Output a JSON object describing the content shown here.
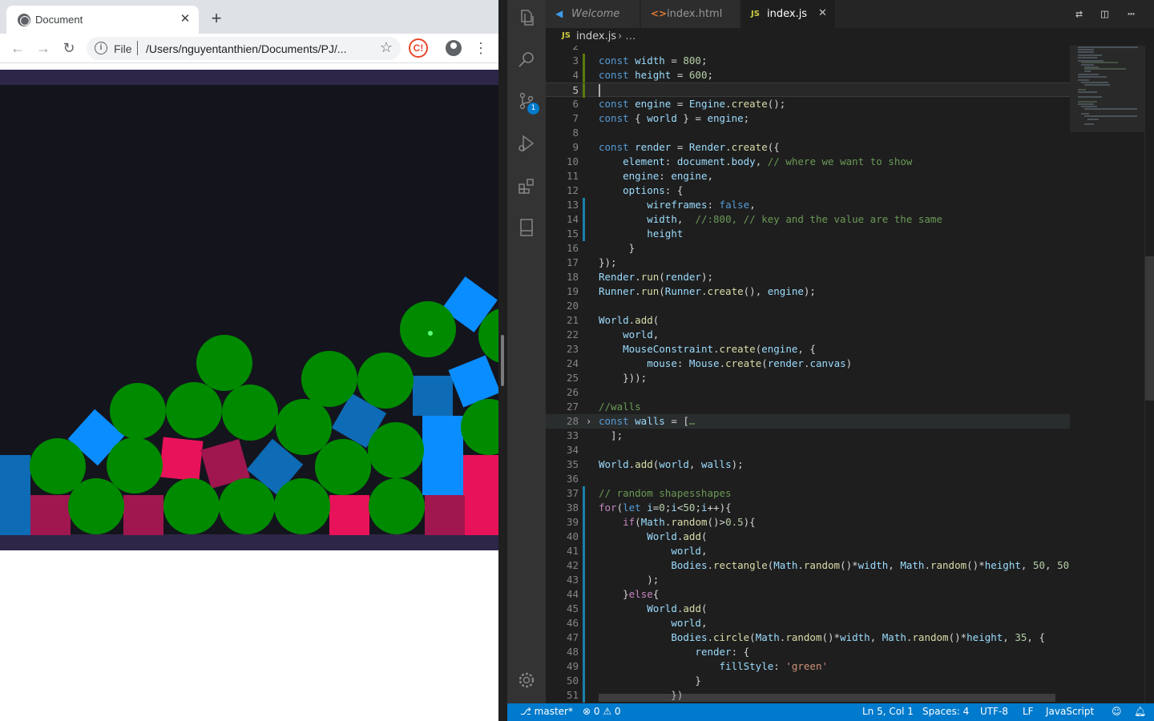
{
  "browser": {
    "tab_title": "Document",
    "tab_close": "✕",
    "new_tab": "+",
    "omnibox_scheme": "File",
    "omnibox_url": "/Users/nguyentanthien/Documents/PJ/...",
    "extension_badge": "C!"
  },
  "canvas": {
    "background": "#14141d",
    "wall_color": "#2e2648",
    "circle_color": "#008a00",
    "rect_colors": [
      "#0e6bb5",
      "#0a8dff",
      "#e8125a",
      "#a0174f"
    ]
  },
  "vscode": {
    "tabs": [
      {
        "icon": "vscode-logo",
        "label": "Welcome",
        "active": false
      },
      {
        "icon": "<>",
        "label": "index.html",
        "active": false
      },
      {
        "icon": "JS",
        "label": "index.js",
        "active": true
      }
    ],
    "breadcrumb": {
      "icon": "JS",
      "file": "index.js",
      "more": "…"
    },
    "scm_badge": "1",
    "lines": [
      {
        "n": "2",
        "tokens": []
      },
      {
        "n": "3",
        "tokens": [
          [
            "kw",
            "const "
          ],
          [
            "var",
            "width"
          ],
          [
            "pun",
            " = "
          ],
          [
            "num",
            "800"
          ],
          [
            "pun",
            ";"
          ]
        ]
      },
      {
        "n": "4",
        "tokens": [
          [
            "kw",
            "const "
          ],
          [
            "var",
            "height"
          ],
          [
            "pun",
            " = "
          ],
          [
            "num",
            "600"
          ],
          [
            "pun",
            ";"
          ]
        ]
      },
      {
        "n": "5",
        "tokens": []
      },
      {
        "n": "6",
        "tokens": [
          [
            "kw",
            "const "
          ],
          [
            "var",
            "engine"
          ],
          [
            "pun",
            " = "
          ],
          [
            "var",
            "Engine"
          ],
          [
            "pun",
            "."
          ],
          [
            "fn",
            "create"
          ],
          [
            "pun",
            "();"
          ]
        ]
      },
      {
        "n": "7",
        "tokens": [
          [
            "kw",
            "const "
          ],
          [
            "pun",
            "{ "
          ],
          [
            "var",
            "world"
          ],
          [
            "pun",
            " } = "
          ],
          [
            "var",
            "engine"
          ],
          [
            "pun",
            ";"
          ]
        ]
      },
      {
        "n": "8",
        "tokens": []
      },
      {
        "n": "9",
        "tokens": [
          [
            "kw",
            "const "
          ],
          [
            "var",
            "render"
          ],
          [
            "pun",
            " = "
          ],
          [
            "var",
            "Render"
          ],
          [
            "pun",
            "."
          ],
          [
            "fn",
            "create"
          ],
          [
            "pun",
            "({"
          ]
        ]
      },
      {
        "n": "10",
        "tokens": [
          [
            "pun",
            "    "
          ],
          [
            "var",
            "element"
          ],
          [
            "pun",
            ": "
          ],
          [
            "var",
            "document"
          ],
          [
            "pun",
            "."
          ],
          [
            "var",
            "body"
          ],
          [
            "pun",
            ", "
          ],
          [
            "cmt",
            "// where we want to show"
          ]
        ]
      },
      {
        "n": "11",
        "tokens": [
          [
            "pun",
            "    "
          ],
          [
            "var",
            "engine"
          ],
          [
            "pun",
            ": "
          ],
          [
            "var",
            "engine"
          ],
          [
            "pun",
            ","
          ]
        ]
      },
      {
        "n": "12",
        "tokens": [
          [
            "pun",
            "    "
          ],
          [
            "var",
            "options"
          ],
          [
            "pun",
            ": {"
          ]
        ]
      },
      {
        "n": "13",
        "tokens": [
          [
            "pun",
            "        "
          ],
          [
            "var",
            "wireframes"
          ],
          [
            "pun",
            ": "
          ],
          [
            "kw",
            "false"
          ],
          [
            "pun",
            ","
          ]
        ]
      },
      {
        "n": "14",
        "tokens": [
          [
            "pun",
            "        "
          ],
          [
            "var",
            "width"
          ],
          [
            "pun",
            ",  "
          ],
          [
            "cmt",
            "//:800, // key and the value are the same"
          ]
        ]
      },
      {
        "n": "15",
        "tokens": [
          [
            "pun",
            "        "
          ],
          [
            "var",
            "height"
          ]
        ]
      },
      {
        "n": "16",
        "tokens": [
          [
            "pun",
            "     }"
          ]
        ]
      },
      {
        "n": "17",
        "tokens": [
          [
            "pun",
            "});"
          ]
        ]
      },
      {
        "n": "18",
        "tokens": [
          [
            "var",
            "Render"
          ],
          [
            "pun",
            "."
          ],
          [
            "fn",
            "run"
          ],
          [
            "pun",
            "("
          ],
          [
            "var",
            "render"
          ],
          [
            "pun",
            ");"
          ]
        ]
      },
      {
        "n": "19",
        "tokens": [
          [
            "var",
            "Runner"
          ],
          [
            "pun",
            "."
          ],
          [
            "fn",
            "run"
          ],
          [
            "pun",
            "("
          ],
          [
            "var",
            "Runner"
          ],
          [
            "pun",
            "."
          ],
          [
            "fn",
            "create"
          ],
          [
            "pun",
            "(), "
          ],
          [
            "var",
            "engine"
          ],
          [
            "pun",
            ");"
          ]
        ]
      },
      {
        "n": "20",
        "tokens": []
      },
      {
        "n": "21",
        "tokens": [
          [
            "var",
            "World"
          ],
          [
            "pun",
            "."
          ],
          [
            "fn",
            "add"
          ],
          [
            "pun",
            "("
          ]
        ]
      },
      {
        "n": "22",
        "tokens": [
          [
            "pun",
            "    "
          ],
          [
            "var",
            "world"
          ],
          [
            "pun",
            ","
          ]
        ]
      },
      {
        "n": "23",
        "tokens": [
          [
            "pun",
            "    "
          ],
          [
            "var",
            "MouseConstraint"
          ],
          [
            "pun",
            "."
          ],
          [
            "fn",
            "create"
          ],
          [
            "pun",
            "("
          ],
          [
            "var",
            "engine"
          ],
          [
            "pun",
            ", {"
          ]
        ]
      },
      {
        "n": "24",
        "tokens": [
          [
            "pun",
            "        "
          ],
          [
            "var",
            "mouse"
          ],
          [
            "pun",
            ": "
          ],
          [
            "var",
            "Mouse"
          ],
          [
            "pun",
            "."
          ],
          [
            "fn",
            "create"
          ],
          [
            "pun",
            "("
          ],
          [
            "var",
            "render"
          ],
          [
            "pun",
            "."
          ],
          [
            "var",
            "canvas"
          ],
          [
            "pun",
            ")"
          ]
        ]
      },
      {
        "n": "25",
        "tokens": [
          [
            "pun",
            "    }));"
          ]
        ]
      },
      {
        "n": "26",
        "tokens": []
      },
      {
        "n": "27",
        "tokens": [
          [
            "cmt",
            "//walls"
          ]
        ]
      },
      {
        "n": "28",
        "tokens": [
          [
            "kw",
            "const "
          ],
          [
            "var",
            "walls"
          ],
          [
            "pun",
            " = ["
          ],
          [
            "cmt",
            "…"
          ]
        ]
      },
      {
        "n": "33",
        "tokens": [
          [
            "pun",
            "  ];"
          ]
        ]
      },
      {
        "n": "34",
        "tokens": []
      },
      {
        "n": "35",
        "tokens": [
          [
            "var",
            "World"
          ],
          [
            "pun",
            "."
          ],
          [
            "fn",
            "add"
          ],
          [
            "pun",
            "("
          ],
          [
            "var",
            "world"
          ],
          [
            "pun",
            ", "
          ],
          [
            "var",
            "walls"
          ],
          [
            "pun",
            ");"
          ]
        ]
      },
      {
        "n": "36",
        "tokens": []
      },
      {
        "n": "37",
        "tokens": [
          [
            "cmt",
            "// random shapesshapes"
          ]
        ]
      },
      {
        "n": "38",
        "tokens": [
          [
            "ctl",
            "for"
          ],
          [
            "pun",
            "("
          ],
          [
            "kw",
            "let "
          ],
          [
            "var",
            "i"
          ],
          [
            "pun",
            "="
          ],
          [
            "num",
            "0"
          ],
          [
            "pun",
            ";"
          ],
          [
            "var",
            "i"
          ],
          [
            "pun",
            "<"
          ],
          [
            "num",
            "50"
          ],
          [
            "pun",
            ";"
          ],
          [
            "var",
            "i"
          ],
          [
            "pun",
            "++){"
          ]
        ]
      },
      {
        "n": "39",
        "tokens": [
          [
            "pun",
            "    "
          ],
          [
            "ctl",
            "if"
          ],
          [
            "pun",
            "("
          ],
          [
            "var",
            "Math"
          ],
          [
            "pun",
            "."
          ],
          [
            "fn",
            "random"
          ],
          [
            "pun",
            "()>"
          ],
          [
            "num",
            "0.5"
          ],
          [
            "pun",
            "){"
          ]
        ]
      },
      {
        "n": "40",
        "tokens": [
          [
            "pun",
            "        "
          ],
          [
            "var",
            "World"
          ],
          [
            "pun",
            "."
          ],
          [
            "fn",
            "add"
          ],
          [
            "pun",
            "("
          ]
        ]
      },
      {
        "n": "41",
        "tokens": [
          [
            "pun",
            "            "
          ],
          [
            "var",
            "world"
          ],
          [
            "pun",
            ","
          ]
        ]
      },
      {
        "n": "42",
        "tokens": [
          [
            "pun",
            "            "
          ],
          [
            "var",
            "Bodies"
          ],
          [
            "pun",
            "."
          ],
          [
            "fn",
            "rectangle"
          ],
          [
            "pun",
            "("
          ],
          [
            "var",
            "Math"
          ],
          [
            "pun",
            "."
          ],
          [
            "fn",
            "random"
          ],
          [
            "pun",
            "()*"
          ],
          [
            "var",
            "width"
          ],
          [
            "pun",
            ", "
          ],
          [
            "var",
            "Math"
          ],
          [
            "pun",
            "."
          ],
          [
            "fn",
            "random"
          ],
          [
            "pun",
            "()*"
          ],
          [
            "var",
            "height"
          ],
          [
            "pun",
            ", "
          ],
          [
            "num",
            "50"
          ],
          [
            "pun",
            ", "
          ],
          [
            "num",
            "50"
          ],
          [
            "pun",
            ")"
          ]
        ]
      },
      {
        "n": "43",
        "tokens": [
          [
            "pun",
            "        );"
          ]
        ]
      },
      {
        "n": "44",
        "tokens": [
          [
            "pun",
            "    }"
          ],
          [
            "ctl",
            "else"
          ],
          [
            "pun",
            "{"
          ]
        ]
      },
      {
        "n": "45",
        "tokens": [
          [
            "pun",
            "        "
          ],
          [
            "var",
            "World"
          ],
          [
            "pun",
            "."
          ],
          [
            "fn",
            "add"
          ],
          [
            "pun",
            "("
          ]
        ]
      },
      {
        "n": "46",
        "tokens": [
          [
            "pun",
            "            "
          ],
          [
            "var",
            "world"
          ],
          [
            "pun",
            ","
          ]
        ]
      },
      {
        "n": "47",
        "tokens": [
          [
            "pun",
            "            "
          ],
          [
            "var",
            "Bodies"
          ],
          [
            "pun",
            "."
          ],
          [
            "fn",
            "circle"
          ],
          [
            "pun",
            "("
          ],
          [
            "var",
            "Math"
          ],
          [
            "pun",
            "."
          ],
          [
            "fn",
            "random"
          ],
          [
            "pun",
            "()*"
          ],
          [
            "var",
            "width"
          ],
          [
            "pun",
            ", "
          ],
          [
            "var",
            "Math"
          ],
          [
            "pun",
            "."
          ],
          [
            "fn",
            "random"
          ],
          [
            "pun",
            "()*"
          ],
          [
            "var",
            "height"
          ],
          [
            "pun",
            ", "
          ],
          [
            "num",
            "35"
          ],
          [
            "pun",
            ", {"
          ]
        ]
      },
      {
        "n": "48",
        "tokens": [
          [
            "pun",
            "                "
          ],
          [
            "var",
            "render"
          ],
          [
            "pun",
            ": {"
          ]
        ]
      },
      {
        "n": "49",
        "tokens": [
          [
            "pun",
            "                    "
          ],
          [
            "var",
            "fillStyle"
          ],
          [
            "pun",
            ": "
          ],
          [
            "str",
            "'green'"
          ]
        ]
      },
      {
        "n": "50",
        "tokens": [
          [
            "pun",
            "                }"
          ]
        ]
      },
      {
        "n": "51",
        "tokens": [
          [
            "pun",
            "            })"
          ]
        ]
      }
    ],
    "status": {
      "branch": "master*",
      "errors": "0",
      "warnings": "0",
      "position": "Ln 5, Col 1",
      "spaces": "Spaces: 4",
      "encoding": "UTF-8",
      "eol": "LF",
      "language": "JavaScript"
    }
  }
}
